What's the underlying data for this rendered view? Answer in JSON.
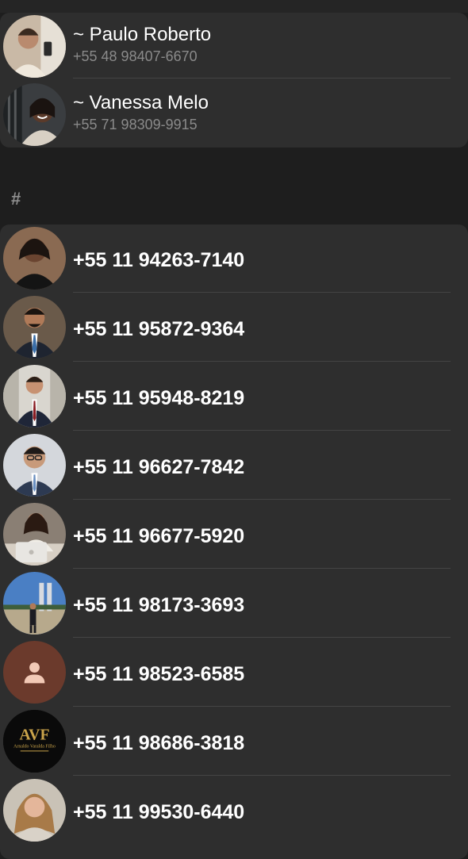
{
  "named_contacts": [
    {
      "name": "~ Paulo Roberto",
      "phone": "+55 48 98407-6670",
      "avatar": "photo-man-selfie"
    },
    {
      "name": "~ Vanessa Melo",
      "phone": "+55 71 98309-9915",
      "avatar": "photo-woman-smiling"
    }
  ],
  "section": {
    "label": "#"
  },
  "number_contacts": [
    {
      "phone": "+55 11 94263-7140",
      "avatar": "photo-woman-black-dress"
    },
    {
      "phone": "+55 11 95872-9364",
      "avatar": "photo-man-suit-blue-tie"
    },
    {
      "phone": "+55 11 95948-8219",
      "avatar": "photo-man-suit-red-tie"
    },
    {
      "phone": "+55 11 96627-7842",
      "avatar": "photo-man-suit-glasses"
    },
    {
      "phone": "+55 11 96677-5920",
      "avatar": "photo-woman-laptop"
    },
    {
      "phone": "+55 11 98173-3693",
      "avatar": "photo-man-outdoor-building"
    },
    {
      "phone": "+55 11 98523-6585",
      "avatar": "default-person-icon"
    },
    {
      "phone": "+55 11 98686-3818",
      "avatar": "avf-logo",
      "logo_text": "AVF",
      "logo_subtext": "Arnaldo Varalda Filho"
    },
    {
      "phone": "+55 11 99530-6440",
      "avatar": "photo-woman-blonde"
    }
  ],
  "colors": {
    "background": "#1e1e1e",
    "card": "#2e2e2e",
    "divider": "#444444",
    "subtext": "#8a8a8a",
    "default_avatar_bg": "#6b3a2c",
    "default_avatar_fg": "#f2c9b6",
    "logo_gold": "#c9a34a"
  }
}
